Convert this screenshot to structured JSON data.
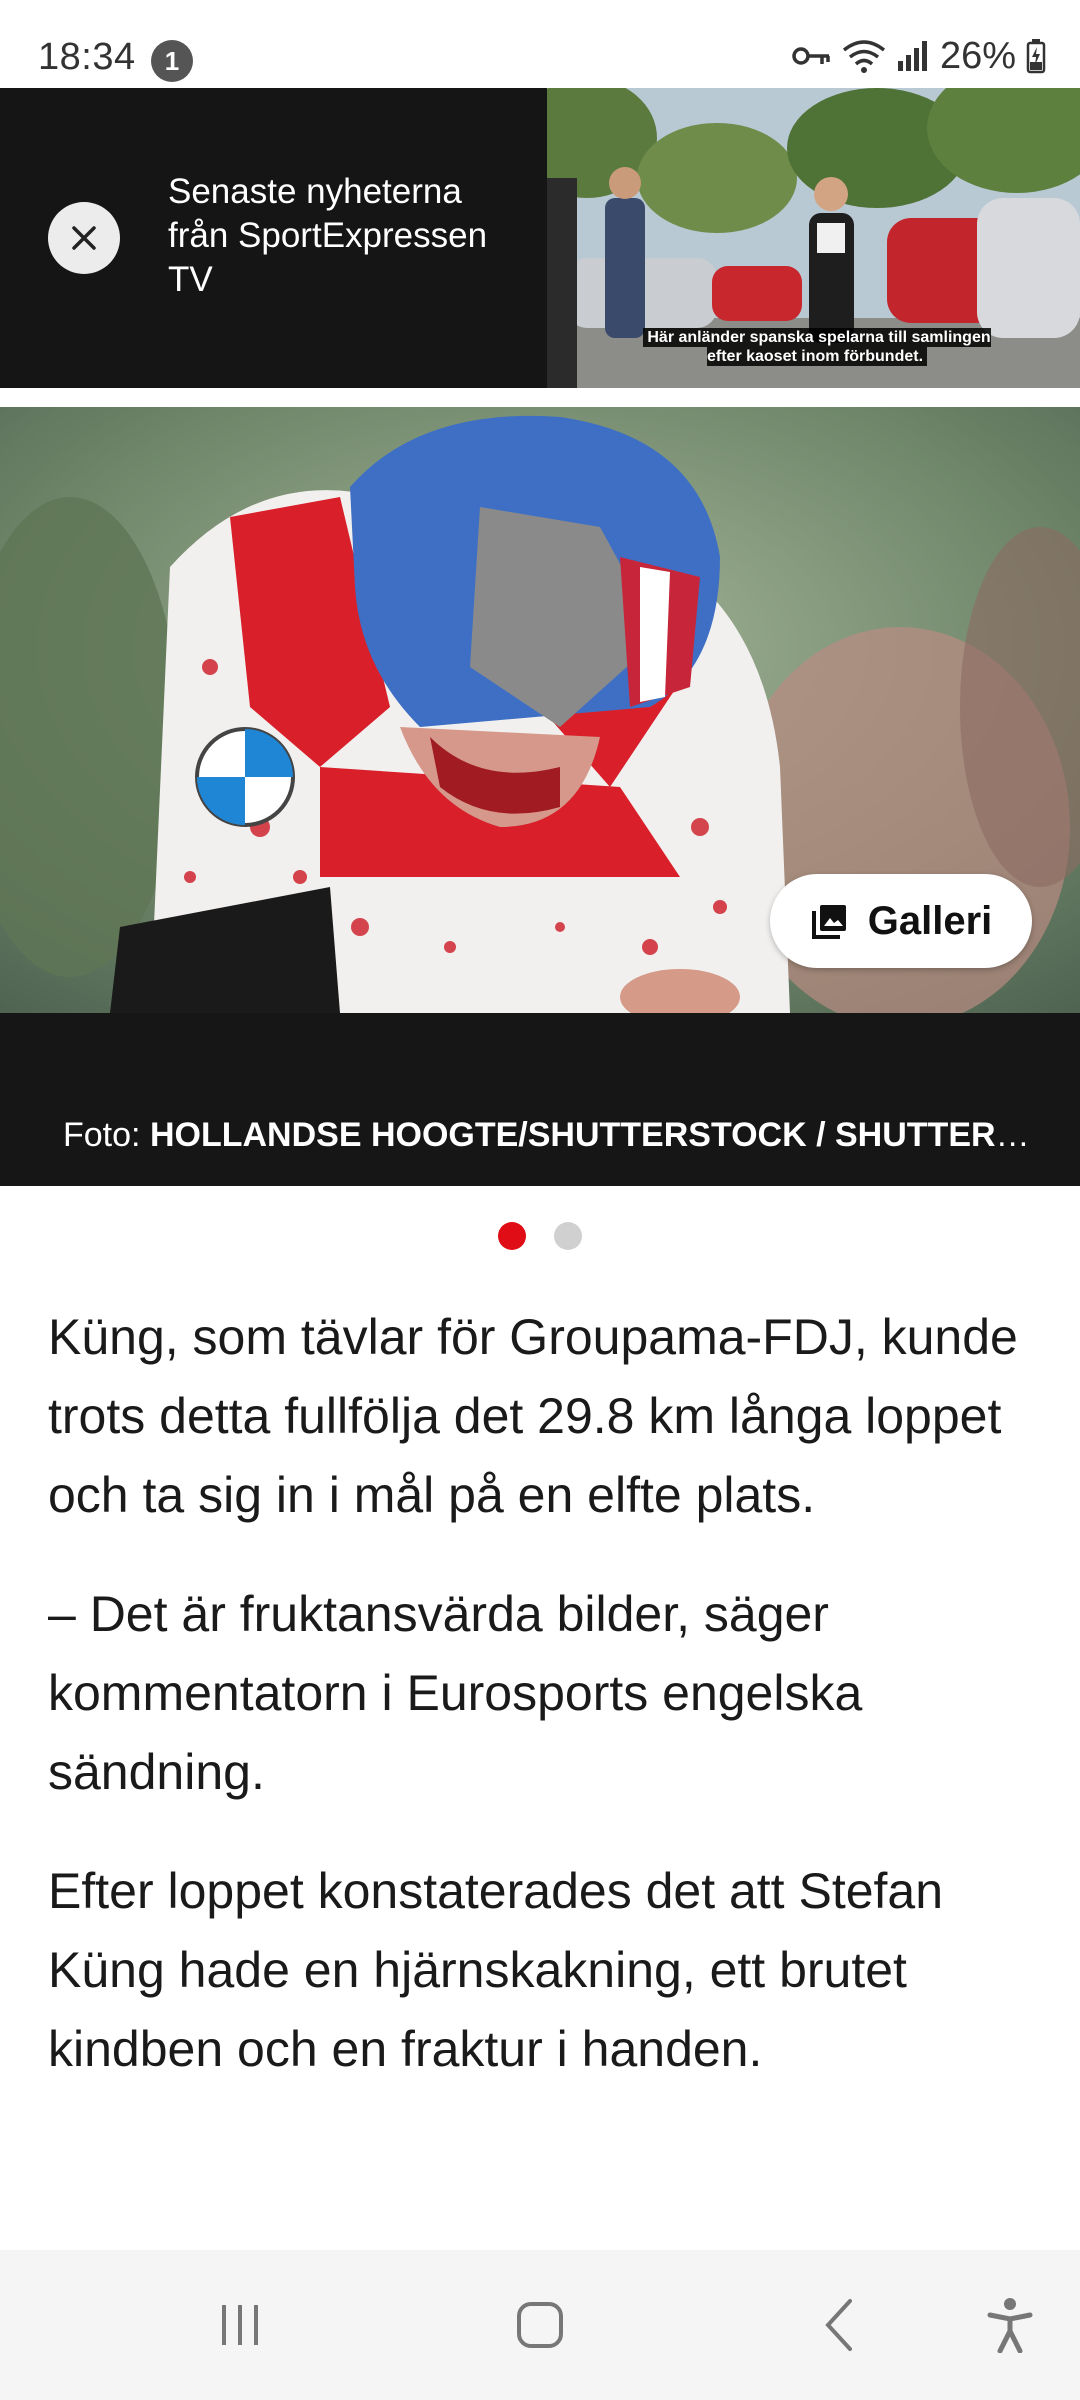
{
  "status_bar": {
    "time": "18:34",
    "notification_count": "1",
    "battery": "26%",
    "icons": [
      "vpn-key-icon",
      "wifi-icon",
      "signal-icon",
      "battery-charging-icon"
    ]
  },
  "video_banner": {
    "text": "Senaste nyheterna från SportExpressen TV",
    "subtitle": "Här anländer spanska spelarna till samlingen efter kaoset inom förbundet.",
    "close_icon": "close-icon"
  },
  "hero": {
    "gallery_label": "Galleri",
    "gallery_icon": "image-gallery-icon"
  },
  "caption": {
    "prefix": "Foto: ",
    "credit": "HOLLANDSE HOOGTE/SHUTTERSTOCK / SHUTTERSTOCK"
  },
  "carousel": {
    "total": 2,
    "active_index": 0
  },
  "article": {
    "paragraphs": [
      "Küng, som tävlar för Groupama-FDJ, kunde trots detta fullfölja det 29.8 km långa loppet och ta sig in i mål på en elfte plats.",
      "– Det är fruktansvärda bilder, säger kommentatorn i Eurosports engelska sändning.",
      "Efter loppet konstaterades det att Stefan Küng hade en hjärnskakning, ett brutet kindben och en fraktur i handen."
    ]
  },
  "nav_bar": {
    "buttons": [
      "recent-apps-icon",
      "home-icon",
      "back-icon",
      "accessibility-icon"
    ]
  },
  "colors": {
    "accent_red": "#e00d16",
    "banner_bg": "#151515",
    "caption_bg": "#161616"
  }
}
